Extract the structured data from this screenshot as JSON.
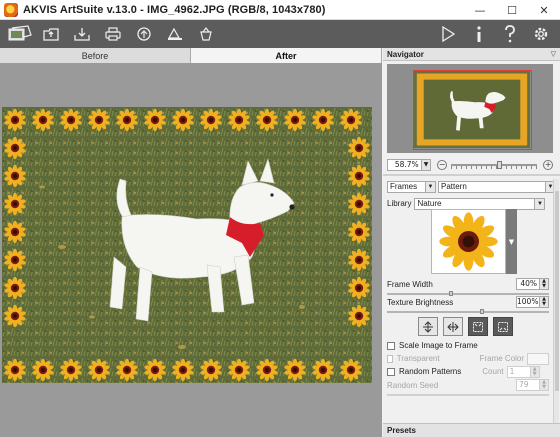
{
  "window": {
    "title": "AKVIS ArtSuite v.13.0 - IMG_4962.JPG (RGB/8, 1043x780)",
    "minimize": "—",
    "maximize": "☐",
    "close": "✕"
  },
  "toolbar": {
    "left_icons": [
      "open-image-icon",
      "open-folder-icon",
      "save-icon",
      "print-icon",
      "share-icon",
      "batch-icon",
      "settings-bucket-icon"
    ],
    "right_icons": [
      "run-icon",
      "info-icon",
      "help-icon",
      "preferences-icon"
    ]
  },
  "tabs": [
    {
      "label": "Before",
      "active": false
    },
    {
      "label": "After",
      "active": true
    }
  ],
  "navigator": {
    "title": "Navigator",
    "zoom_value": "58.7%",
    "zoom_minus": "−",
    "zoom_plus": "+"
  },
  "effect": {
    "category": "Frames",
    "type": "Pattern",
    "library_label": "Library",
    "library_value": "Nature",
    "frame_width_label": "Frame Width",
    "frame_width_value": "40%",
    "texture_brightness_label": "Texture Brightness",
    "texture_brightness_value": "100%",
    "scale_image_label": "Scale Image to Frame",
    "transparent_label": "Transparent",
    "frame_color_label": "Frame Color",
    "random_patterns_label": "Random Patterns",
    "count_label": "Count",
    "count_value": "1",
    "random_seed_label": "Random Seed",
    "random_seed_value": "79"
  },
  "presets": {
    "title": "Presets"
  },
  "colors": {
    "toolbar_bg": "#5c5c5c",
    "canvas_bg": "#9a9a9a",
    "nav_highlight": "#e23b3b"
  }
}
